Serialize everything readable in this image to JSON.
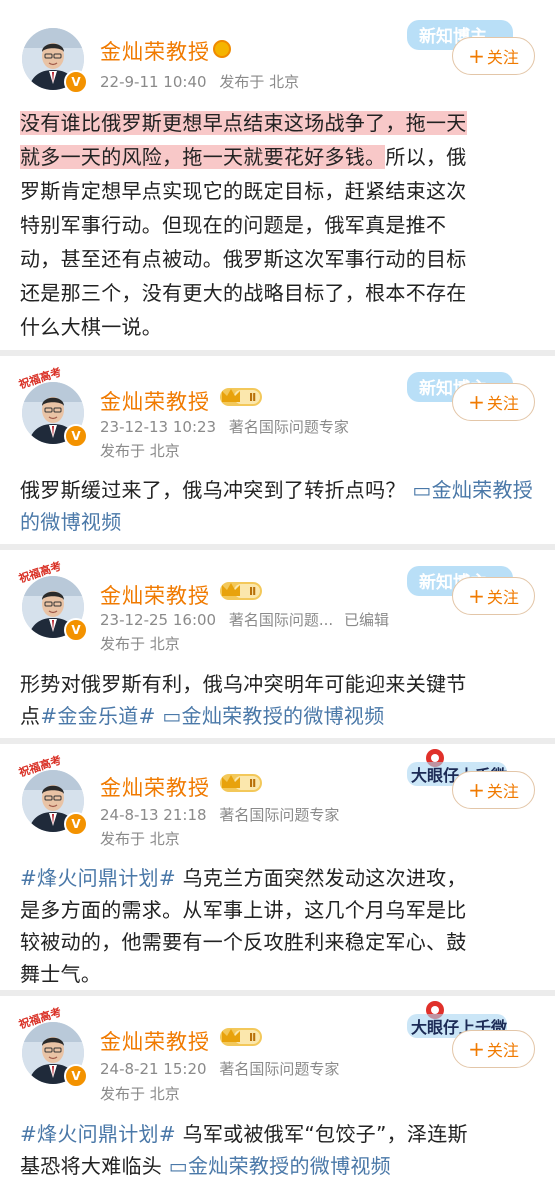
{
  "posts": [
    {
      "name": "金灿荣教授",
      "time": "22-9-11 10:40",
      "location": "发布于 北京",
      "role": "",
      "follow_label": "关注",
      "sticker": "新知博主",
      "content": {
        "highlight1": "没有谁比俄罗斯更想早点结束这场战争了，拖一天",
        "highlight2": "就多一天的风险，拖一天就要花好多钱。",
        "rest2": "所以，俄",
        "line3": "罗斯肯定想早点实现它的既定目标，赶紧结束这次",
        "line4": "特别军事行动。但现在的问题是，俄军真是推不",
        "line5": "动，甚至还有点被动。俄罗斯这次军事行动的目标",
        "line6": "还是那三个，没有更大的战略目标了，根本不存在",
        "line7": "什么大棋一说。"
      }
    },
    {
      "name": "金灿荣教授",
      "level": "Ⅱ",
      "time": "23-12-13 10:23",
      "role": "著名国际问题专家",
      "location": "发布于 北京",
      "follow_label": "关注",
      "sticker": "新知博主",
      "deco": "祝福高考",
      "content": {
        "text": "俄罗斯缓过来了，俄乌冲突到了转折点吗？",
        "link": "金灿荣教授的微博视频"
      }
    },
    {
      "name": "金灿荣教授",
      "level": "Ⅱ",
      "time": "23-12-25 16:00",
      "role": "著名国际问题...",
      "edited": "已编辑",
      "location": "发布于 北京",
      "follow_label": "关注",
      "sticker": "新知博主",
      "deco": "祝福高考",
      "content": {
        "line1": "形势对俄罗斯有利，俄乌冲突明年可能迎来关键节",
        "line2_start": "点",
        "tag": "#金金乐道#",
        "link": "金灿荣教授的微博视频"
      }
    },
    {
      "name": "金灿荣教授",
      "level": "Ⅱ",
      "time": "24-8-13 21:18",
      "role": "著名国际问题专家",
      "location": "发布于 北京",
      "follow_label": "关注",
      "sticker": "大眼仔上千微",
      "deco": "祝福高考",
      "content": {
        "tag": "#烽火问鼎计划#",
        "line1_rest": " 乌克兰方面突然发动这次进攻，",
        "line2": "是多方面的需求。从军事上讲，这几个月乌军是比",
        "line3": "较被动的，他需要有一个反攻胜利来稳定军心、鼓",
        "line4": "舞士气。"
      }
    },
    {
      "name": "金灿荣教授",
      "level": "Ⅱ",
      "time": "24-8-21 15:20",
      "role": "著名国际问题专家",
      "location": "发布于 北京",
      "follow_label": "关注",
      "sticker": "大眼仔上千微",
      "deco": "祝福高考",
      "content": {
        "tag": "#烽火问鼎计划#",
        "line1_rest": " 乌军或被俄军“包饺子”，泽连斯",
        "line2": "基恐将大难临头",
        "link": "金灿荣教授的微博视频"
      }
    }
  ],
  "colors": {
    "name": "#f07a00",
    "link": "#4a78a8",
    "highlight": "#f8c8c8",
    "meta": "#8a8a8a"
  },
  "icons": [
    "verified-v-icon",
    "crown-level-icon",
    "video-link-icon",
    "plus-icon"
  ]
}
